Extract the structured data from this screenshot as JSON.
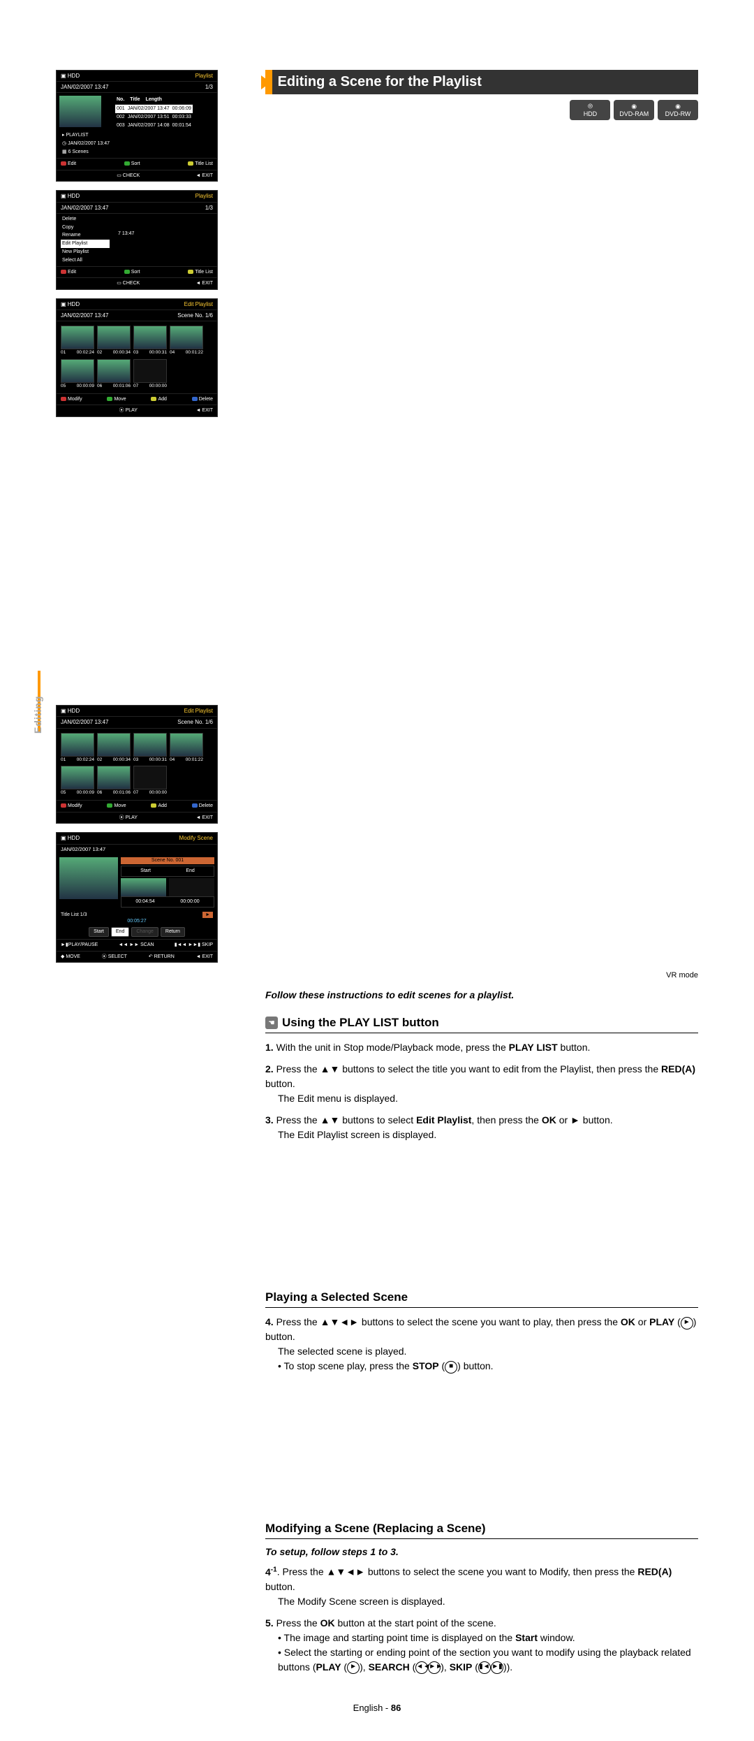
{
  "side_label": "Editing",
  "section_title": "Editing a Scene for the Playlist",
  "media_labels": {
    "hdd": "HDD",
    "dvdram": "DVD-RAM",
    "dvdrw": "DVD-RW"
  },
  "vr_mode": "VR mode",
  "instruction_line": "Follow these instructions to edit scenes for a playlist.",
  "sub_playlist": "Using the PLAY LIST button",
  "steps_a": [
    {
      "n": "1.",
      "pre": "With the unit in Stop mode/Playback mode, press the ",
      "b1": "PLAY LIST",
      "post": " button."
    },
    {
      "n": "2.",
      "pre": "Press the ▲▼ buttons to select the title you want to edit from the Playlist, then press the ",
      "b1": "RED(A)",
      "post": " button."
    },
    {
      "n": "3.",
      "pre": "Press the ▲▼ buttons to select ",
      "b1": "Edit Playlist",
      "mid": ", then press the ",
      "b2": "OK",
      "post": " or ► button."
    }
  ],
  "steps_a_notes": [
    "The Edit menu is displayed.",
    "The Edit Playlist screen is displayed."
  ],
  "sub_play_scene": "Playing a Selected Scene",
  "step4_n": "4.",
  "step4_pre": "Press the ▲▼◄► buttons to select the scene you want to play, then press the ",
  "step4_b1": "OK",
  "step4_mid": " or ",
  "step4_b2": "PLAY",
  "step4_post": " button.",
  "step4_note": "The selected scene is played.",
  "step4_bullet_pre": "To stop scene play, press the ",
  "step4_bullet_b": "STOP",
  "step4_bullet_post": " button.",
  "sub_modify": "Modifying a Scene (Replacing a Scene)",
  "setup_note": "To setup, follow steps 1 to 3.",
  "step4_1_n": "4",
  "step4_1_sup": "-1",
  "step4_1_pre": ". Press the ▲▼◄► buttons to select the scene you want to Modify, then press the ",
  "step4_1_b": "RED(A)",
  "step4_1_post": " button.",
  "step4_1_note": "The Modify Scene screen is displayed.",
  "step5_n": "5.",
  "step5_pre": "Press the ",
  "step5_b": "OK",
  "step5_post": " button at the start point of the scene.",
  "step5_b1_pre": "The image and starting point time is displayed on the ",
  "step5_b1_b": "Start",
  "step5_b1_post": " window.",
  "step5_b2_pre": "Select the starting or ending point of the section you want to modify using the playback related buttons (",
  "step5_b2_play": "PLAY",
  "step5_b2_search": "SEARCH",
  "step5_b2_skip": "SKIP",
  "step5_b2_post": ").",
  "footer": {
    "lang": "English",
    "dash": " - ",
    "page": "86"
  },
  "osd1": {
    "device": "HDD",
    "mode": "Playlist",
    "date": "JAN/02/2007 13:47",
    "count": "1/3",
    "table_hdr": {
      "no": "No.",
      "title": "Title",
      "len": "Length"
    },
    "rows": [
      {
        "no": "001",
        "t": "JAN/02/2007 13:47",
        "l": "00:06:09"
      },
      {
        "no": "002",
        "t": "JAN/02/2007 13:51",
        "l": "00:03:33"
      },
      {
        "no": "003",
        "t": "JAN/02/2007 14:08",
        "l": "00:01:54"
      }
    ],
    "info": [
      "PLAYLIST",
      "JAN/02/2007 13:47",
      "6 Scenes"
    ],
    "foot": {
      "a": "Edit",
      "b": "Sort",
      "c": "Title List",
      "d": "CHECK",
      "e": "EXIT"
    }
  },
  "osd2": {
    "device": "HDD",
    "mode": "Playlist",
    "date": "JAN/02/2007 13:47",
    "count": "1/3",
    "menu": [
      "Delete",
      "Copy",
      "Rename",
      "Edit Playlist",
      "New Playlist",
      "Select All"
    ],
    "menu_sel": "Edit Playlist",
    "menu_time": "7 13:47",
    "foot": {
      "a": "Edit",
      "b": "Sort",
      "c": "Title List",
      "d": "CHECK",
      "e": "EXIT"
    }
  },
  "osd3": {
    "device": "HDD",
    "mode": "Edit Playlist",
    "date": "JAN/02/2007 13:47",
    "count": "Scene No. 1/6",
    "scenes": [
      {
        "n": "01",
        "t": "00:02:24"
      },
      {
        "n": "02",
        "t": "00:00:34"
      },
      {
        "n": "03",
        "t": "00:00:31"
      },
      {
        "n": "04",
        "t": "00:01:22"
      },
      {
        "n": "05",
        "t": "00:00:09"
      },
      {
        "n": "06",
        "t": "00:01:06"
      },
      {
        "n": "07",
        "t": "00:00:00"
      }
    ],
    "foot": {
      "a": "Modify",
      "b": "Move",
      "c": "Add",
      "d": "Delete",
      "e": "PLAY",
      "f": "EXIT"
    }
  },
  "osd4": {
    "device": "HDD",
    "mode": "Modify Scene",
    "date": "JAN/02/2007 13:47",
    "scene_no": "Scene No. 001",
    "start": "Start",
    "end": "End",
    "start_t": "00:04:54",
    "end_t": "00:00:00",
    "title": "Title List 1/3",
    "play_t": "00:05:27",
    "btns": [
      "Start",
      "End",
      "Change",
      "Return"
    ],
    "btn_sel": "End",
    "foot": {
      "a": "PLAY/PAUSE",
      "b": "SCAN",
      "c": "SKIP",
      "d": "MOVE",
      "e": "SELECT",
      "f": "RETURN",
      "g": "EXIT"
    }
  }
}
